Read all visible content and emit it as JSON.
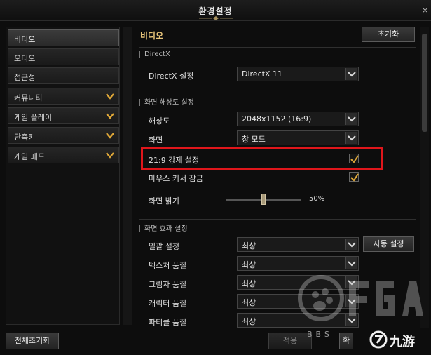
{
  "window": {
    "title": "환경설정",
    "close_glyph": "×"
  },
  "sidebar": {
    "items": [
      {
        "label": "비디오",
        "active": true,
        "chevron": false
      },
      {
        "label": "오디오",
        "active": false,
        "chevron": false
      },
      {
        "label": "접근성",
        "active": false,
        "chevron": false
      },
      {
        "label": "커뮤니티",
        "active": false,
        "chevron": true
      },
      {
        "label": "게임 플레이",
        "active": false,
        "chevron": true
      },
      {
        "label": "단축키",
        "active": false,
        "chevron": true
      },
      {
        "label": "게임 패드",
        "active": false,
        "chevron": true
      }
    ]
  },
  "main": {
    "section_title": "비디오",
    "reset_label": "초기화",
    "groups": {
      "directx": "DirectX",
      "resolution": "화면 해상도 설정",
      "effects": "화면 효과 설정"
    },
    "rows": {
      "directx_setting": {
        "label": "DirectX 설정",
        "value": "DirectX 11"
      },
      "resolution": {
        "label": "해상도",
        "value": "2048x1152 (16:9)"
      },
      "screen": {
        "label": "화면",
        "value": "창 모드"
      },
      "force_219": {
        "label": "21:9 강제 설정",
        "checked": true
      },
      "mouse_lock": {
        "label": "마우스 커서 잠금",
        "checked": true
      },
      "brightness": {
        "label": "화면 밝기",
        "value": 50,
        "display": "50%"
      },
      "overall": {
        "label": "일괄 설정",
        "value": "최상",
        "auto_label": "자동 설정"
      },
      "texture": {
        "label": "텍스처 품질",
        "value": "최상"
      },
      "shadow": {
        "label": "그림자 품질",
        "value": "최상"
      },
      "character": {
        "label": "캐릭터 품질",
        "value": "최상"
      },
      "particle": {
        "label": "파티클 품질",
        "value": "최상"
      }
    }
  },
  "footer": {
    "reset_all_label": "전체초기화",
    "apply_label": "적용",
    "ok_label": "확"
  },
  "watermark": {
    "text": "BBS",
    "brand": "九游"
  },
  "colors": {
    "accent": "#e8c57a",
    "highlight": "#e0161b",
    "chevron": "#e0a838"
  }
}
